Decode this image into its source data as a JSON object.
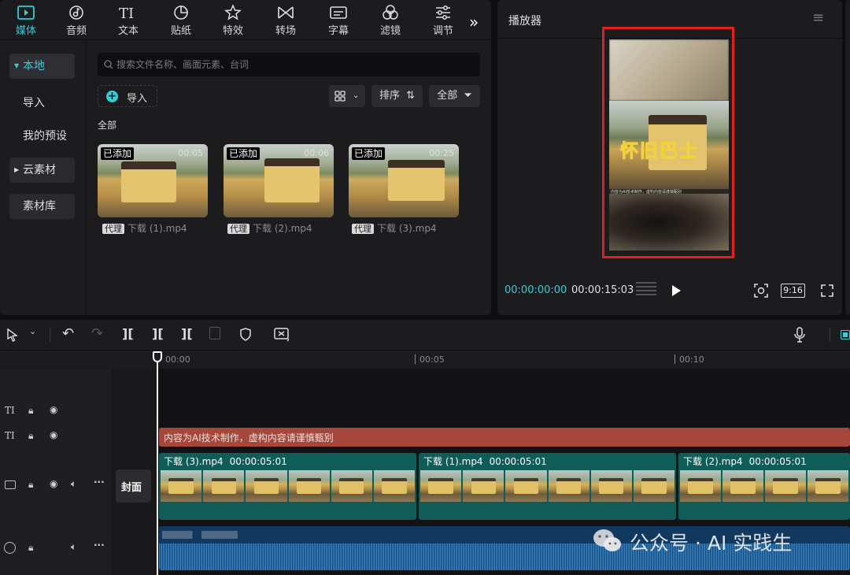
{
  "tabs": [
    {
      "label": "媒体",
      "icon": "media-icon",
      "active": true
    },
    {
      "label": "音频",
      "icon": "audio-icon"
    },
    {
      "label": "文本",
      "icon": "text-icon"
    },
    {
      "label": "贴纸",
      "icon": "sticker-icon"
    },
    {
      "label": "特效",
      "icon": "effects-icon"
    },
    {
      "label": "转场",
      "icon": "transition-icon"
    },
    {
      "label": "字幕",
      "icon": "caption-icon"
    },
    {
      "label": "滤镜",
      "icon": "filter-icon"
    },
    {
      "label": "调节",
      "icon": "adjust-icon"
    }
  ],
  "sidebar": {
    "local": "本地",
    "import": "导入",
    "presets": "我的预设",
    "cloud": "云素材",
    "library": "素材库"
  },
  "media": {
    "search_placeholder": "搜索文件名称、画面元素、台词",
    "import_label": "导入",
    "sort_label": "排序",
    "all_filter_label": "全部",
    "section_label": "全部",
    "items": [
      {
        "tag": "已添加",
        "duration": "00:05",
        "proxy": "代理",
        "name": "下载 (1).mp4"
      },
      {
        "tag": "已添加",
        "duration": "00:06",
        "proxy": "代理",
        "name": "下载 (2).mp4"
      },
      {
        "tag": "已添加",
        "duration": "00:25",
        "proxy": "代理",
        "name": "下载 (3).mp4"
      }
    ]
  },
  "player": {
    "title": "播放器",
    "overlay_title": "怀旧巴士",
    "overlay_subtitle": "内容为AI技术制作，虚构内容请谨慎甄别",
    "current_time": "00:00:00:00",
    "total_time": "00:00:15:03",
    "ratio": "9:16"
  },
  "timeline": {
    "ruler": [
      "00:00",
      "00:05",
      "00:10"
    ],
    "cover_label": "封面",
    "text_clip": "内容为AI技术制作，虚构内容请谨慎甄别",
    "clips": [
      {
        "name": "下载 (3).mp4",
        "duration": "00:00:05:01"
      },
      {
        "name": "下载 (1).mp4",
        "duration": "00:00:05:01"
      },
      {
        "name": "下载 (2).mp4",
        "duration": "00:00:05:01"
      }
    ]
  },
  "watermark": "公众号 · AI 实践生",
  "colors": {
    "accent": "#2fd0d8",
    "text_clip": "#a5483b",
    "video_clip": "#0f5c58",
    "audio_track": "#11385e",
    "highlight_box": "#e02020"
  }
}
